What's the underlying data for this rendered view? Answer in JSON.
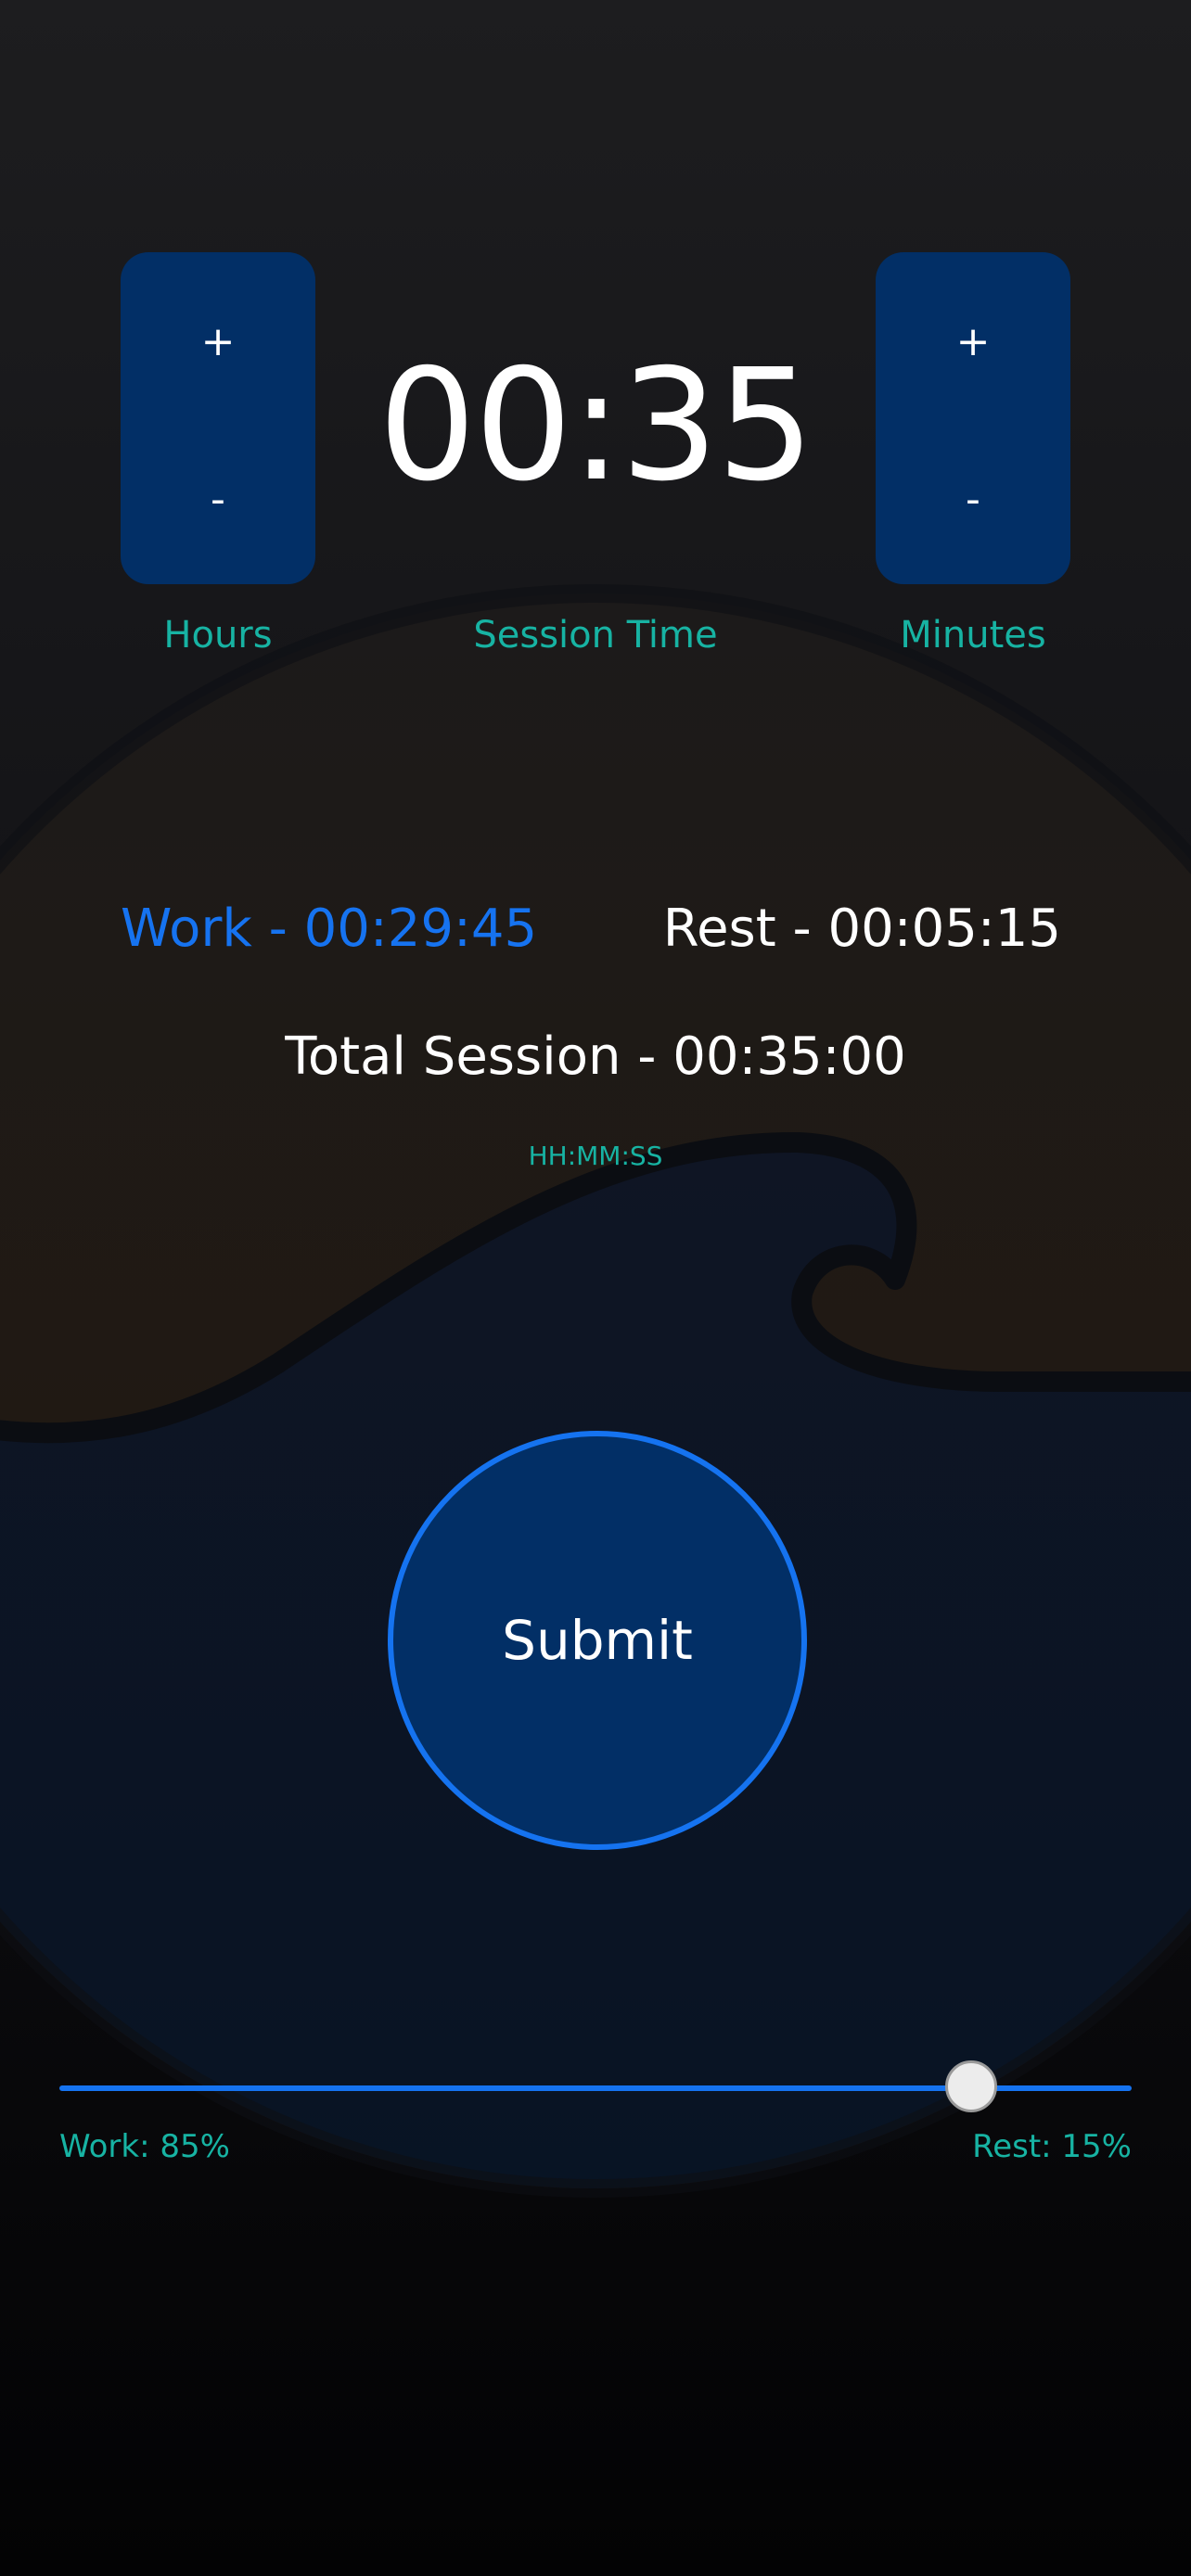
{
  "session": {
    "display": "00:35",
    "label": "Session Time"
  },
  "hours_stepper": {
    "increment_label": "+",
    "decrement_label": "-",
    "label": "Hours"
  },
  "minutes_stepper": {
    "increment_label": "+",
    "decrement_label": "-",
    "label": "Minutes"
  },
  "breakdown": {
    "work": "Work - 00:29:45",
    "rest": "Rest - 00:05:15",
    "total": "Total Session - 00:35:00",
    "format_hint": "HH:MM:SS"
  },
  "submit": {
    "label": "Submit"
  },
  "ratio_slider": {
    "work_fraction": 0.85,
    "work_label": "Work: 85%",
    "rest_label": "Rest: 15%"
  },
  "colors": {
    "accent_blue": "#1573f0",
    "panel_navy": "#022f66",
    "teal_text": "#17b3a3",
    "sunset_orange": "#2a1c12",
    "wave_blue": "#0c1628"
  },
  "icons": {
    "background": "ocean-wave-illustration"
  }
}
